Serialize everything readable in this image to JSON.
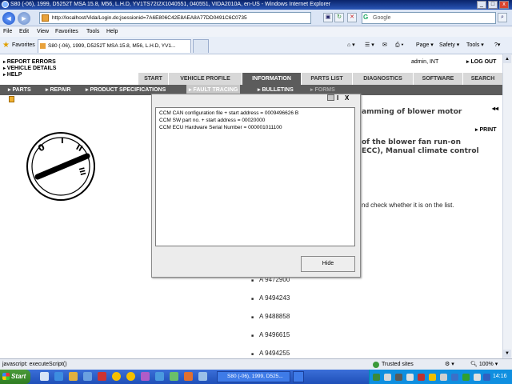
{
  "window": {
    "title": "S80 (-06), 1999, D5252T MSA 15.8, M56, L.H.D, YV1TS72I2X1040551, 040551, VIDA2010A, en-US - Windows Internet Explorer",
    "min": "_",
    "max": "□",
    "close": "x"
  },
  "browser": {
    "back": "◄",
    "forward": "►",
    "address": "http://localhost/Vida/Login.do;jsessionid=7A6E806C42E8AEA8A77DD0491C6C0735",
    "search_placeholder": "Google",
    "menu": [
      "File",
      "Edit",
      "View",
      "Favorites",
      "Tools",
      "Help"
    ],
    "favorites_label": "Favorites",
    "tab_title": "S80 (-06), 1999, D5252T MSA 15.8, M56, L.H.D, YV1...",
    "commands": [
      "Page ▾",
      "Safety ▾",
      "Tools ▾"
    ]
  },
  "vida": {
    "top_links": [
      "REPORT ERRORS",
      "VEHICLE DETAILS",
      "HELP"
    ],
    "user": "admin, INT",
    "logout": "LOG OUT",
    "main_tabs": [
      "START",
      "VEHICLE PROFILE",
      "INFORMATION",
      "PARTS LIST",
      "DIAGNOSTICS",
      "SOFTWARE",
      "SEARCH"
    ],
    "active_main_tab": "INFORMATION",
    "sub_tabs": [
      "PARTS",
      "REPAIR",
      "PRODUCT SPECIFICATIONS",
      "FAULT TRACING",
      "BULLETINS",
      "FORMS"
    ],
    "active_sub_tab": "FAULT TRACING",
    "content": {
      "heading_fragment": "amming of blower motor",
      "print": "PRINT",
      "line1": "of the blower fan run-on",
      "line2": "ECC), Manual climate control",
      "instruction": "nd check whether it is on the list.",
      "parts": [
        "A 9472900",
        "A 9494243",
        "A 9488858",
        "A 9496615",
        "A 9494255"
      ]
    }
  },
  "dialog": {
    "lines": [
      "CCM CAN configuration file + start address = 0009496626  B",
      "CCM SW part no. + start address = 00020000",
      "CCM ECU Hardware Serial Number = 000001011100"
    ],
    "info": "I",
    "close": "X",
    "hide_label": "Hide"
  },
  "statusbar": {
    "text": "javascript: executeScript()",
    "zone": "Trusted sites",
    "zoom": "100%"
  },
  "taskbar": {
    "start": "Start",
    "task_label": "S80 (-06), 1999, D525...",
    "clock": "14:16"
  },
  "colors": {
    "nav_dark": "#5c5c5c",
    "nav_light": "#d8d8d8",
    "ie_blue": "#2a56b8",
    "xp_taskbar": "#2456c7"
  }
}
